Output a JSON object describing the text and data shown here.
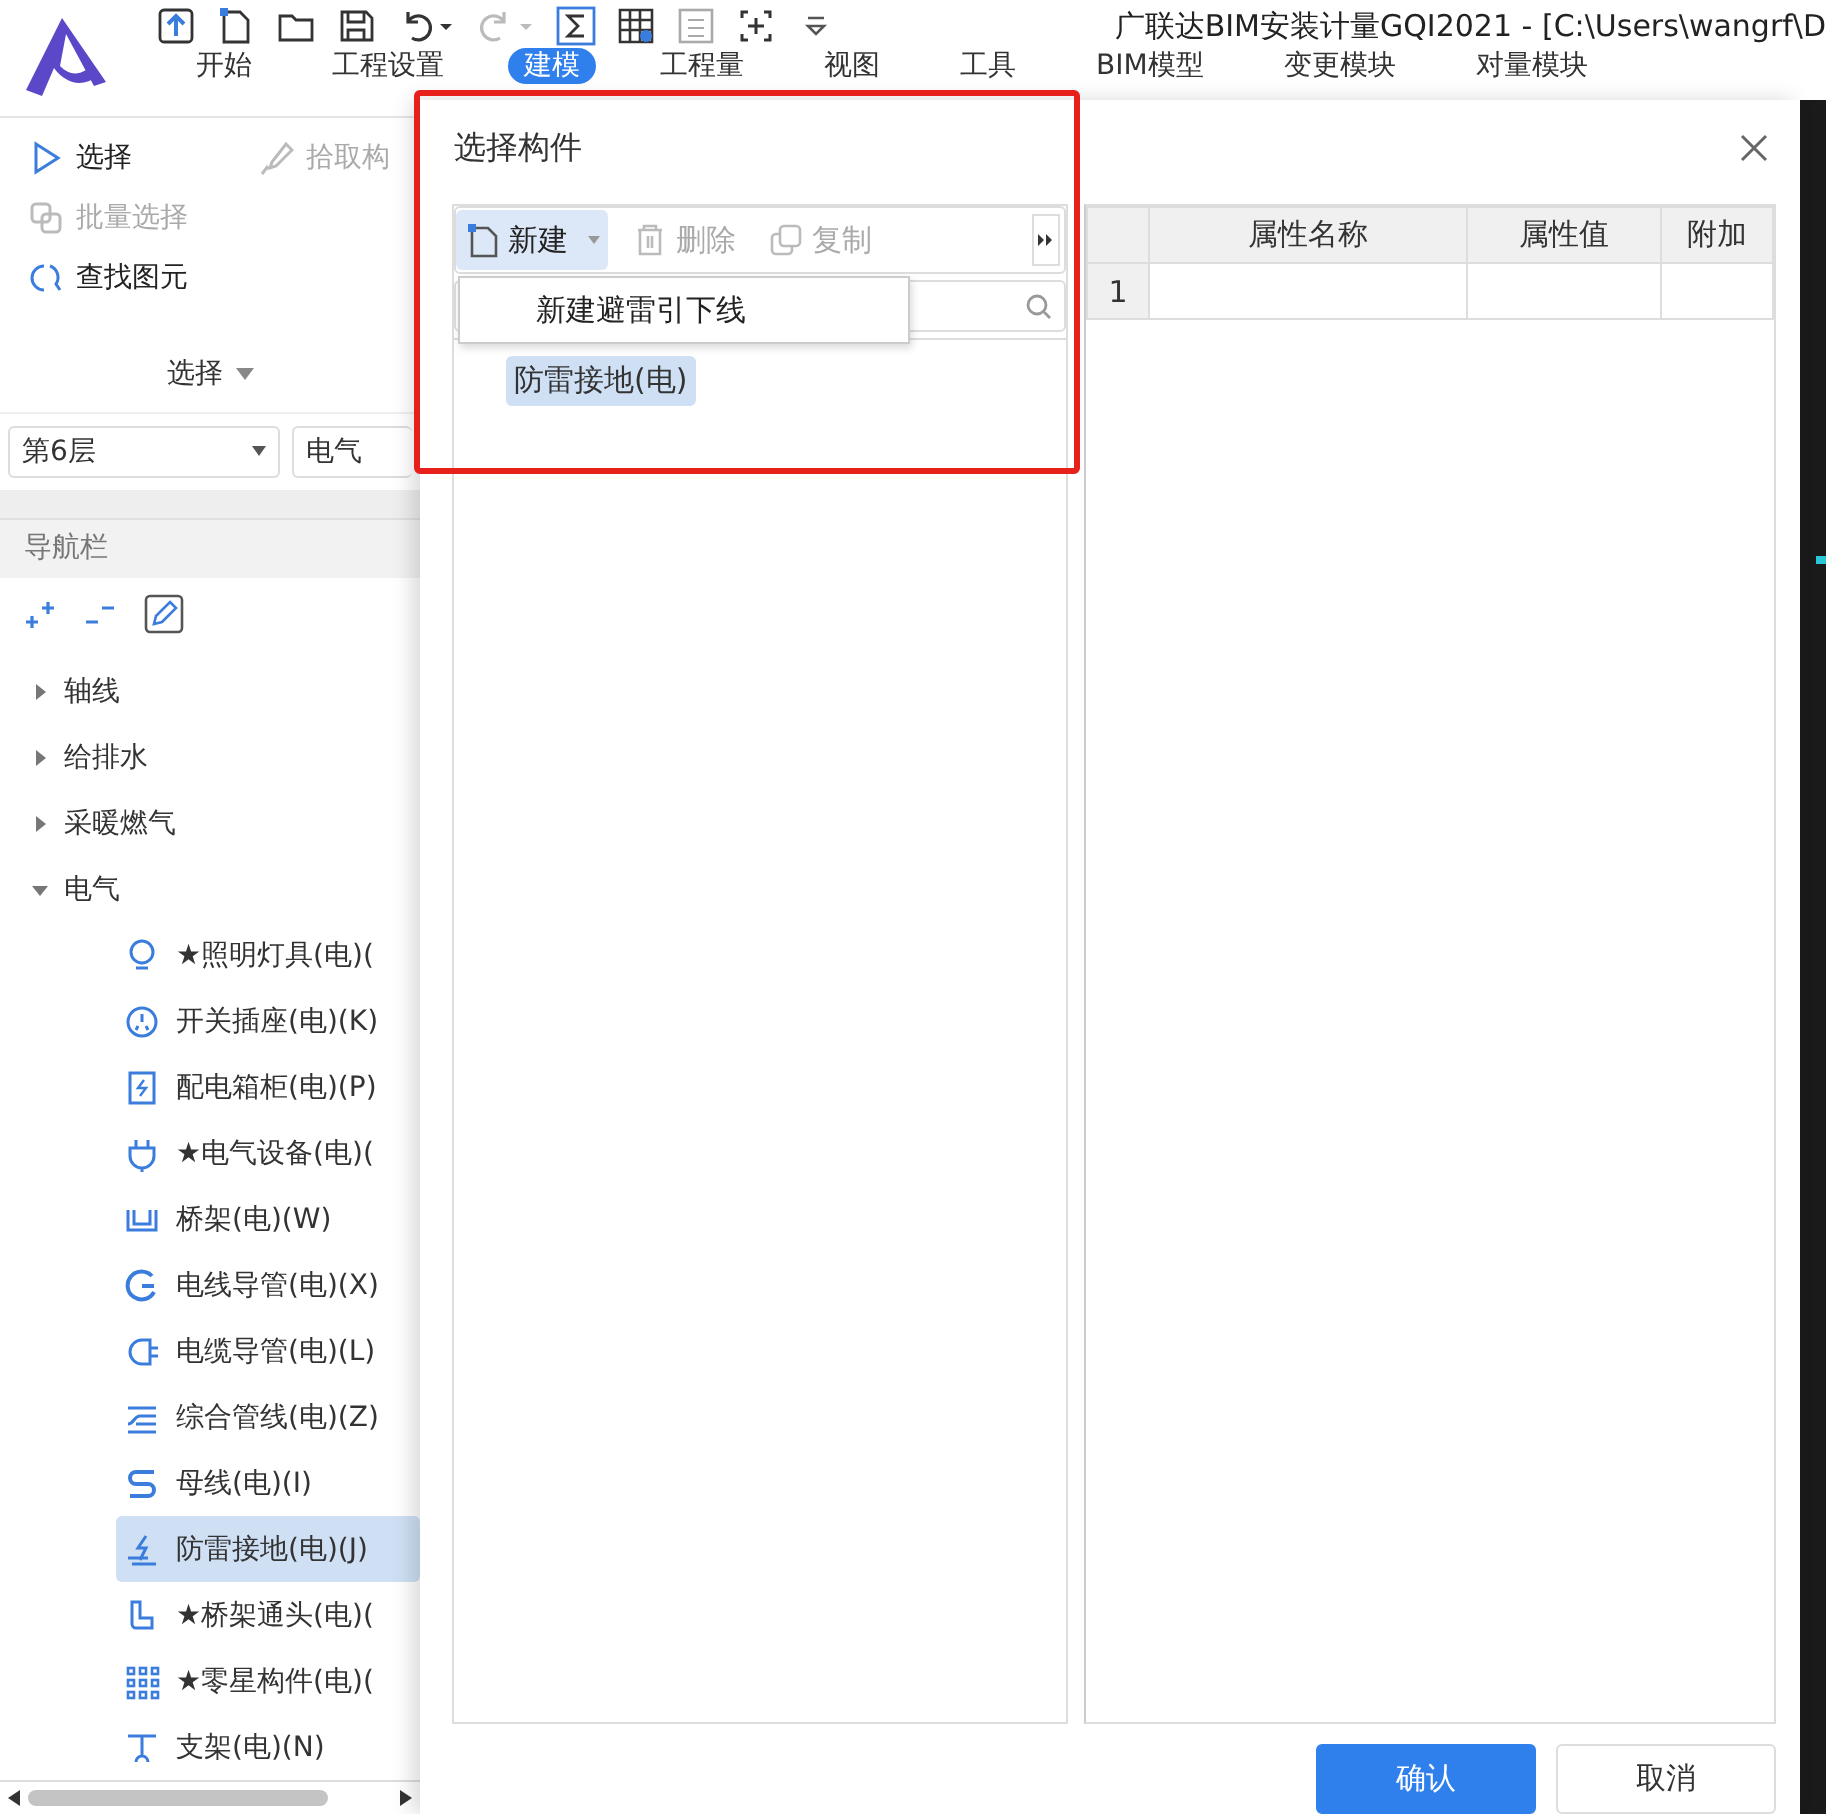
{
  "window": {
    "title": "广联达BIM安装计量GQI2021 - [C:\\Users\\wangrf\\D"
  },
  "ribbon_tabs": [
    {
      "label": "开始",
      "selected": false
    },
    {
      "label": "工程设置",
      "selected": false
    },
    {
      "label": "建模",
      "selected": true
    },
    {
      "label": "工程量",
      "selected": false
    },
    {
      "label": "视图",
      "selected": false
    },
    {
      "label": "工具",
      "selected": false
    },
    {
      "label": "BIM模型",
      "selected": false
    },
    {
      "label": "变更模块",
      "selected": false
    },
    {
      "label": "对量模块",
      "selected": false
    }
  ],
  "select_group": {
    "tools": [
      {
        "label": "选择",
        "disabled": false
      },
      {
        "label": "拾取构",
        "disabled": true
      },
      {
        "label": "批量选择",
        "disabled": true
      },
      {
        "label": "查找图元",
        "disabled": false
      }
    ],
    "group_label": "选择"
  },
  "filters": {
    "floor": "第6层",
    "discipline": "电气"
  },
  "navigation": {
    "title": "导航栏",
    "tree": [
      {
        "label": "轴线",
        "expanded": false
      },
      {
        "label": "给排水",
        "expanded": false
      },
      {
        "label": "采暖燃气",
        "expanded": false
      },
      {
        "label": "电气",
        "expanded": true,
        "children": [
          {
            "label": "★照明灯具(电)(",
            "selected": false
          },
          {
            "label": "开关插座(电)(K)",
            "selected": false
          },
          {
            "label": "配电箱柜(电)(P)",
            "selected": false
          },
          {
            "label": "★电气设备(电)(",
            "selected": false
          },
          {
            "label": "桥架(电)(W)",
            "selected": false
          },
          {
            "label": "电线导管(电)(X)",
            "selected": false
          },
          {
            "label": "电缆导管(电)(L)",
            "selected": false
          },
          {
            "label": "综合管线(电)(Z)",
            "selected": false
          },
          {
            "label": "母线(电)(I)",
            "selected": false
          },
          {
            "label": "防雷接地(电)(J)",
            "selected": true
          },
          {
            "label": "★桥架通头(电)(",
            "selected": false
          },
          {
            "label": "★零星构件(电)(",
            "selected": false
          },
          {
            "label": "支架(电)(N)",
            "selected": false
          }
        ]
      }
    ]
  },
  "dialog": {
    "title": "选择构件",
    "toolbar": [
      {
        "label": "新建",
        "disabled": false
      },
      {
        "label": "删除",
        "disabled": true
      },
      {
        "label": "复制",
        "disabled": true
      }
    ],
    "new_menu": {
      "items": [
        "新建避雷引下线"
      ]
    },
    "components": [
      {
        "label": "防雷接地(电)",
        "selected": true
      }
    ],
    "properties": {
      "columns": [
        "属性名称",
        "属性值",
        "附加"
      ],
      "rows": [
        {
          "index": "1"
        }
      ]
    },
    "buttons": [
      {
        "label": "确认",
        "kind": "primary"
      },
      {
        "label": "取消",
        "kind": "secondary"
      }
    ]
  }
}
